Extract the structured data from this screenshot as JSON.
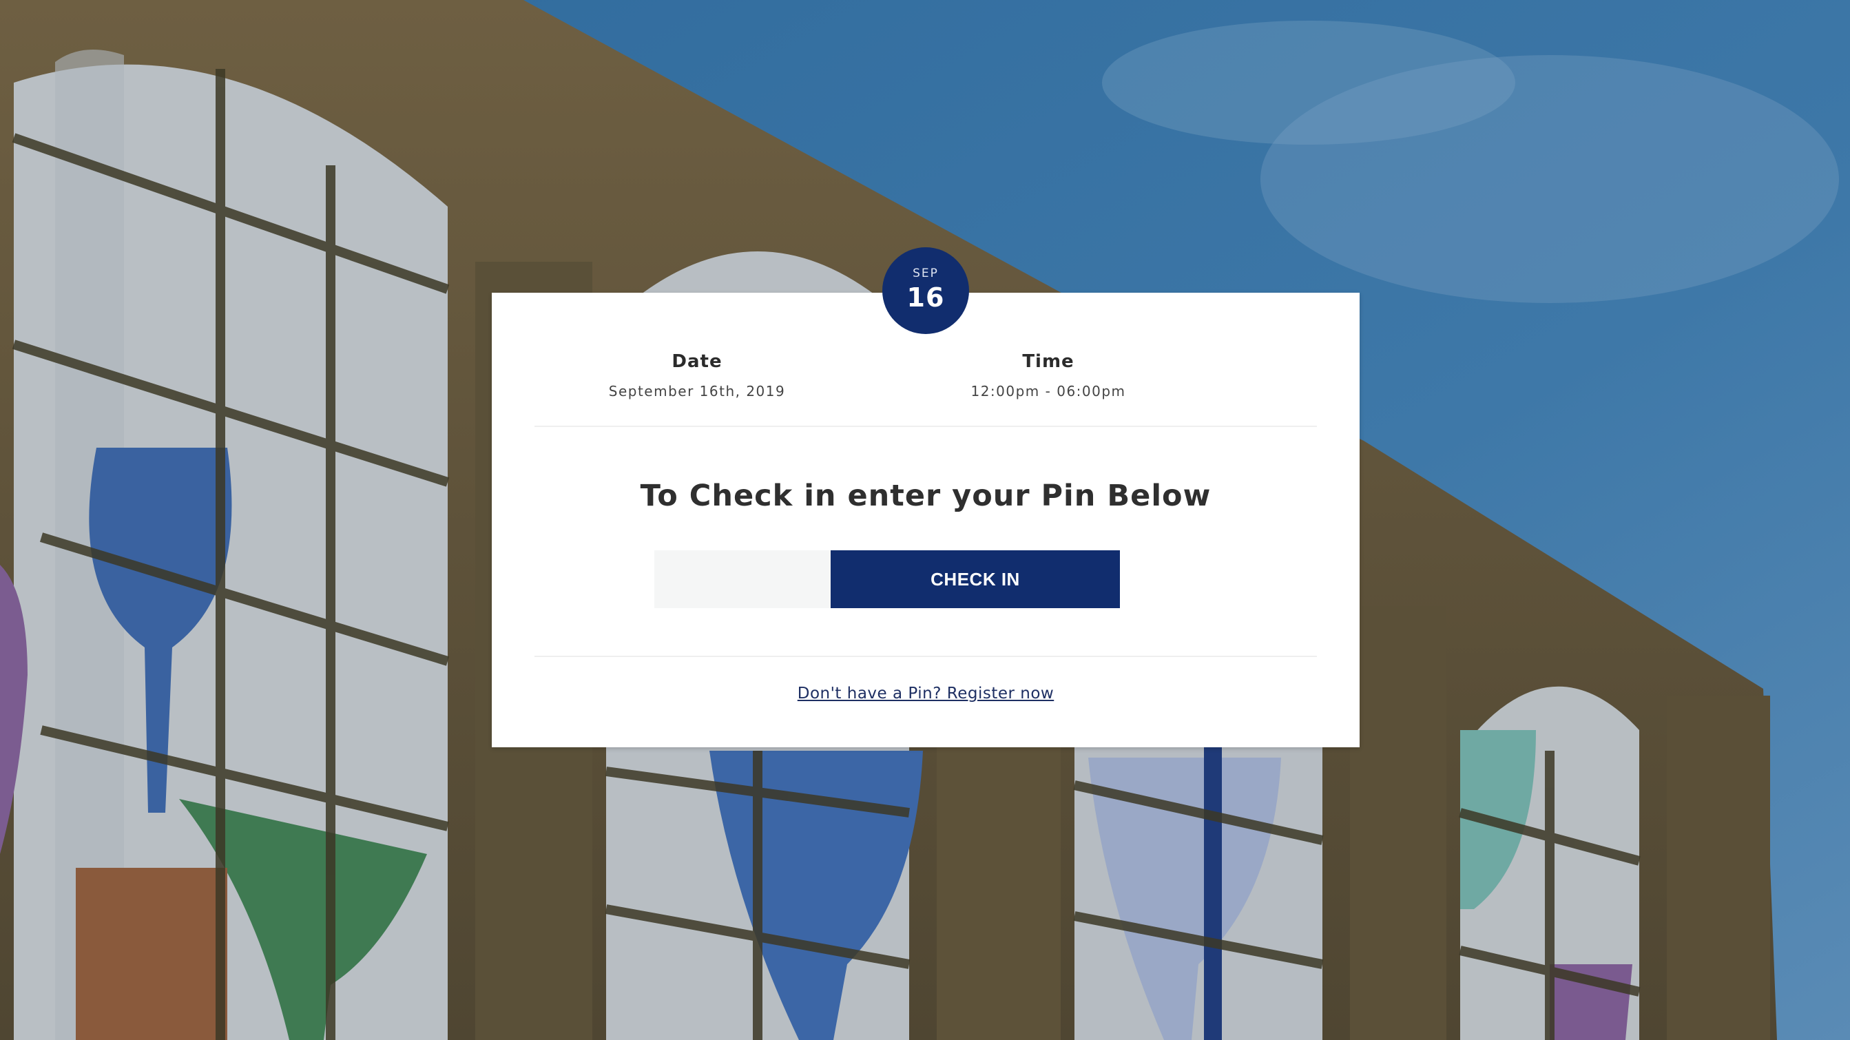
{
  "badge": {
    "month": "SEP",
    "day": "16"
  },
  "event": {
    "date_label": "Date",
    "date_value": "September 16th, 2019",
    "time_label": "Time",
    "time_value": "12:00pm - 06:00pm"
  },
  "checkin": {
    "heading": "To Check in enter your Pin Below",
    "pin_value": "",
    "button_label": "CHECK IN",
    "register_link": "Don't have a Pin? Register now"
  },
  "colors": {
    "primary": "#112d6e",
    "sky": "#3d6f9c",
    "stone": "#8a7552",
    "card": "#ffffff"
  }
}
